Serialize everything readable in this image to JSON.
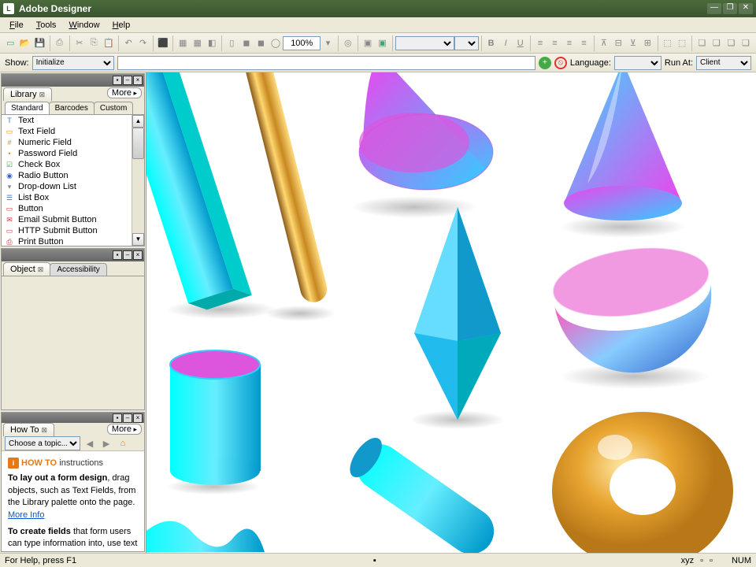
{
  "window": {
    "title": "Adobe Designer"
  },
  "menu": {
    "file": "File",
    "tools": "Tools",
    "window": "Window",
    "help": "Help"
  },
  "toolbar": {
    "zoom": "100%"
  },
  "showbar": {
    "show_label": "Show:",
    "show_value": "Initialize",
    "language_label": "Language:",
    "runat_label": "Run At:",
    "runat_value": "Client"
  },
  "panels": {
    "library": {
      "title": "Library",
      "more": "More",
      "subtabs": {
        "standard": "Standard",
        "barcodes": "Barcodes",
        "custom": "Custom"
      },
      "items": [
        "Text",
        "Text Field",
        "Numeric Field",
        "Password Field",
        "Check Box",
        "Radio Button",
        "Drop-down List",
        "List Box",
        "Button",
        "Email Submit Button",
        "HTTP Submit Button",
        "Print Button"
      ]
    },
    "object": {
      "title": "Object",
      "tab2": "Accessibility"
    },
    "howto": {
      "title": "How To",
      "more": "More",
      "topic_placeholder": "Choose a topic...",
      "hdr": "HOW TO",
      "hdr2": "instructions",
      "p1a": "To lay out a form design",
      "p1b": ", drag objects, such as Text Fields, from the Library palette onto the page. ",
      "p2a": "To create fields",
      "p2b": " that form users can type information into, use text field objects. ",
      "moreinfo": "More Info"
    }
  },
  "status": {
    "help": "For Help, press F1",
    "num": "NUM"
  }
}
